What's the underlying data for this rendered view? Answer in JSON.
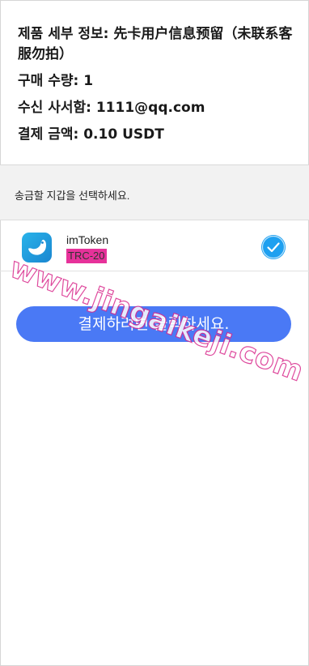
{
  "details": {
    "product_label": "제품 세부 정보:",
    "product_value": "先卡用户信息预留（未联系客服勿拍）",
    "quantity_label": "구매 수량:",
    "quantity_value": "1",
    "email_label": "수신 사서함:",
    "email_value": "1111@qq.com",
    "amount_label": "결제 금액:",
    "amount_value": "0.10 USDT"
  },
  "wallet_prompt": "송금할 지갑을 선택하세요.",
  "wallet": {
    "name": "imToken",
    "network": "TRC-20",
    "selected": true,
    "icon": "imtoken-logo-icon"
  },
  "pay_button_label": "결제하려면 클릭하세요.",
  "watermark": "www.jingaikeji.com",
  "colors": {
    "accent": "#4a79f5",
    "check": "#1ea0f0",
    "network_highlight": "#e6329a",
    "watermark": "#d92a8c"
  }
}
